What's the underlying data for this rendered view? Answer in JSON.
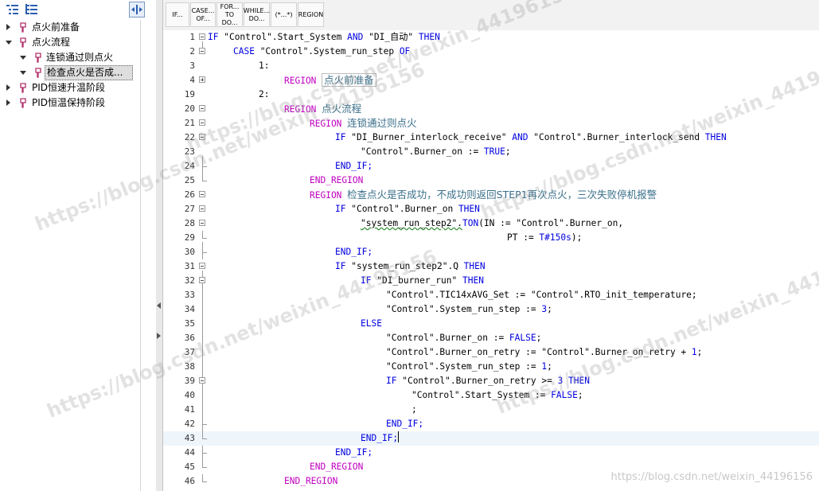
{
  "left_panel": {
    "tree": [
      {
        "label": "点火前准备",
        "expanded": false,
        "level": 0
      },
      {
        "label": "点火流程",
        "expanded": true,
        "level": 0
      },
      {
        "label": "连锁通过则点火",
        "expanded": true,
        "level": 1
      },
      {
        "label": "检查点火是否成...",
        "expanded": true,
        "level": 1,
        "selected": true
      },
      {
        "label": "PID恒速升温阶段",
        "expanded": false,
        "level": 0
      },
      {
        "label": "PID恒温保持阶段",
        "expanded": false,
        "level": 0
      }
    ]
  },
  "toolbar": {
    "buttons": [
      "IF...",
      "CASE... OF...",
      "FOR... TO DO...",
      "WHILE... DO...",
      "(*...*)",
      "REGION"
    ]
  },
  "editor": {
    "current_line": 43,
    "lines": [
      {
        "n": "1"
      },
      {
        "n": "2"
      },
      {
        "n": "3"
      },
      {
        "n": "4"
      },
      {
        "n": "19"
      },
      {
        "n": "20"
      },
      {
        "n": "21"
      },
      {
        "n": "22"
      },
      {
        "n": "23"
      },
      {
        "n": "24"
      },
      {
        "n": "25"
      },
      {
        "n": "26"
      },
      {
        "n": "27"
      },
      {
        "n": "28"
      },
      {
        "n": "29"
      },
      {
        "n": "30"
      },
      {
        "n": "31"
      },
      {
        "n": "32"
      },
      {
        "n": "33"
      },
      {
        "n": "34"
      },
      {
        "n": "35"
      },
      {
        "n": "36"
      },
      {
        "n": "37"
      },
      {
        "n": "38"
      },
      {
        "n": "39"
      },
      {
        "n": "40"
      },
      {
        "n": "41"
      },
      {
        "n": "42"
      },
      {
        "n": "43"
      },
      {
        "n": "44"
      },
      {
        "n": "45"
      },
      {
        "n": "46"
      }
    ],
    "text": {
      "l1a": "IF ",
      "l1b": "\"Control\".Start_System ",
      "l1c": "AND",
      "l1d": " \"DI_自动\" ",
      "l1e": "THEN",
      "l2a": "CASE",
      "l2b": " \"Control\".System_run_step ",
      "l2c": "OF",
      "l3": "1:",
      "l4a": "REGION",
      "l4b": "点火前准备",
      "l19": "2:",
      "l20a": "REGION",
      "l20b": "点火流程",
      "l21a": "REGION",
      "l21b": "连锁通过则点火",
      "l22a": "IF",
      "l22b": " \"DI_Burner_interlock_receive\" ",
      "l22c": "AND",
      "l22d": " \"Control\".Burner_interlock_send ",
      "l22e": "THEN",
      "l23a": "\"Control\".Burner_on := ",
      "l23b": "TRUE",
      "l23c": ";",
      "l24": "END_IF;",
      "l25": "END_REGION",
      "l26a": "REGION",
      "l26b": "检查点火是否成功，不成功则返回STEP1再次点火，三次失败停机报警",
      "l27a": "IF",
      "l27b": " \"Control\".Burner_on ",
      "l27c": "THEN",
      "l28a": "\"system_run_step2\".",
      "l28b": "TON",
      "l28c": "(IN := \"Control\".Burner_on,",
      "l29a": "PT := ",
      "l29b": "T#150s",
      "l29c": ");",
      "l30": "END_IF;",
      "l31a": "IF",
      "l31b": " \"system_run_step2\".Q ",
      "l31c": "THEN",
      "l32a": "IF",
      "l32b": " \"DI_burner_run\" ",
      "l32c": "THEN",
      "l33": "\"Control\".TIC14xAVG_Set := \"Control\".RTO_init_temperature;",
      "l34a": "\"Control\".System_run_step := ",
      "l34b": "3",
      "l34c": ";",
      "l35": "ELSE",
      "l36a": "\"Control\".Burner_on := ",
      "l36b": "FALSE",
      "l36c": ";",
      "l37a": "\"Control\".Burner_on_retry := \"Control\".Burner_on_retry + ",
      "l37b": "1",
      "l37c": ";",
      "l38a": "\"Control\".System_run_step := ",
      "l38b": "1",
      "l38c": ";",
      "l39a": "IF",
      "l39b": " \"Control\".Burner_on_retry >= ",
      "l39c": "3",
      "l39d": " THEN",
      "l40a": "\"Control\".Start_System := ",
      "l40b": "FALSE",
      "l40c": ";",
      "l41": ";",
      "l42": "END_IF;",
      "l43": "END_IF;",
      "l44": "END_IF;",
      "l45": "END_REGION",
      "l46": "END_REGION"
    }
  },
  "watermarks": {
    "csdn": "https://blog.csdn.net/weixin_44196156",
    "footer": "https://blog.csdn.net/weixin_44196156"
  },
  "colors": {
    "keyword": "#0000e0",
    "region": "#c000c0",
    "chinese_comment": "#3a6f8a",
    "current_line_bg": "#eef6fc"
  }
}
